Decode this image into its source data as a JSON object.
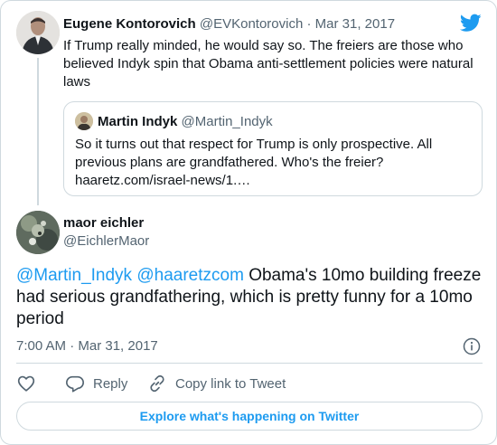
{
  "parent_tweet": {
    "author_name": "Eugene Kontorovich",
    "author_handle": "@EVKontorovich",
    "separator": "·",
    "date": "Mar 31, 2017",
    "text": "If Trump really minded, he would say so. The freiers are those who believed Indyk spin that Obama anti-settlement policies were natural laws",
    "quoted_tweet": {
      "author_name": "Martin Indyk",
      "author_handle": "@Martin_Indyk",
      "text_line1": "So it turns out that respect for Trump is only prospective. All",
      "text_line2": "previous plans are grandfathered. Who's the freier?",
      "text_line3": "haaretz.com/israel-news/1.…"
    }
  },
  "main_tweet": {
    "author_name": "maor eichler",
    "author_handle": "@EichlerMaor",
    "mention_1": "@Martin_Indyk",
    "mention_2": "@haaretzcom",
    "text_rest": "Obama's 10mo building freeze had serious grandfathering, which is pretty funny for a 10mo period",
    "timestamp": "7:00 AM · Mar 31, 2017"
  },
  "actions": {
    "like_icon": "heart-icon",
    "reply_label": "Reply",
    "copy_label": "Copy link to Tweet"
  },
  "explore_label": "Explore what's happening on Twitter",
  "colors": {
    "accent": "#1d9bf0",
    "text": "#0f1419",
    "secondary_text": "#536471",
    "border": "#cfd9de"
  }
}
